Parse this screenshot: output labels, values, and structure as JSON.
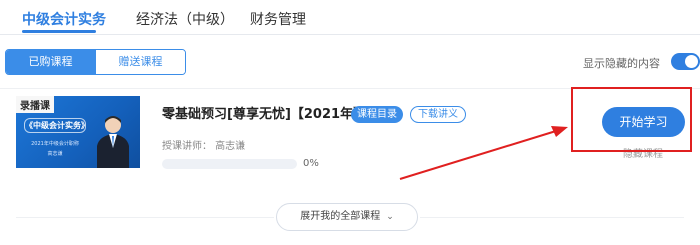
{
  "tabs": [
    {
      "label": "中级会计实务",
      "active": true
    },
    {
      "label": "经济法（中级）",
      "active": false
    },
    {
      "label": "财务管理",
      "active": false
    }
  ],
  "segment": {
    "purchased": "已购课程",
    "gifted": "赠送课程",
    "selected": "已购课程"
  },
  "toggle": {
    "label": "显示隐藏的内容",
    "on": true
  },
  "course": {
    "thumbnail": {
      "tag": "录播课",
      "title": "《中级会计实务》",
      "subtitle": "2021年中级会计职称",
      "teacher_name": "高志谦"
    },
    "title": "零基础预习[尊享无忧]【2021年】",
    "catalog_label": "课程目录",
    "download_label": "下载讲义",
    "teacher": "授课讲师：  高志谦",
    "progress": 0,
    "progress_text": "0%",
    "start_label": "开始学习",
    "hide_label": "隐藏课程"
  },
  "expand_label": "展开我的全部课程",
  "colors": {
    "accent": "#2f7fe0",
    "highlight": "#e02020"
  },
  "icons": {
    "expand": "chevron-down-icon",
    "toggle": "toggle-switch"
  }
}
